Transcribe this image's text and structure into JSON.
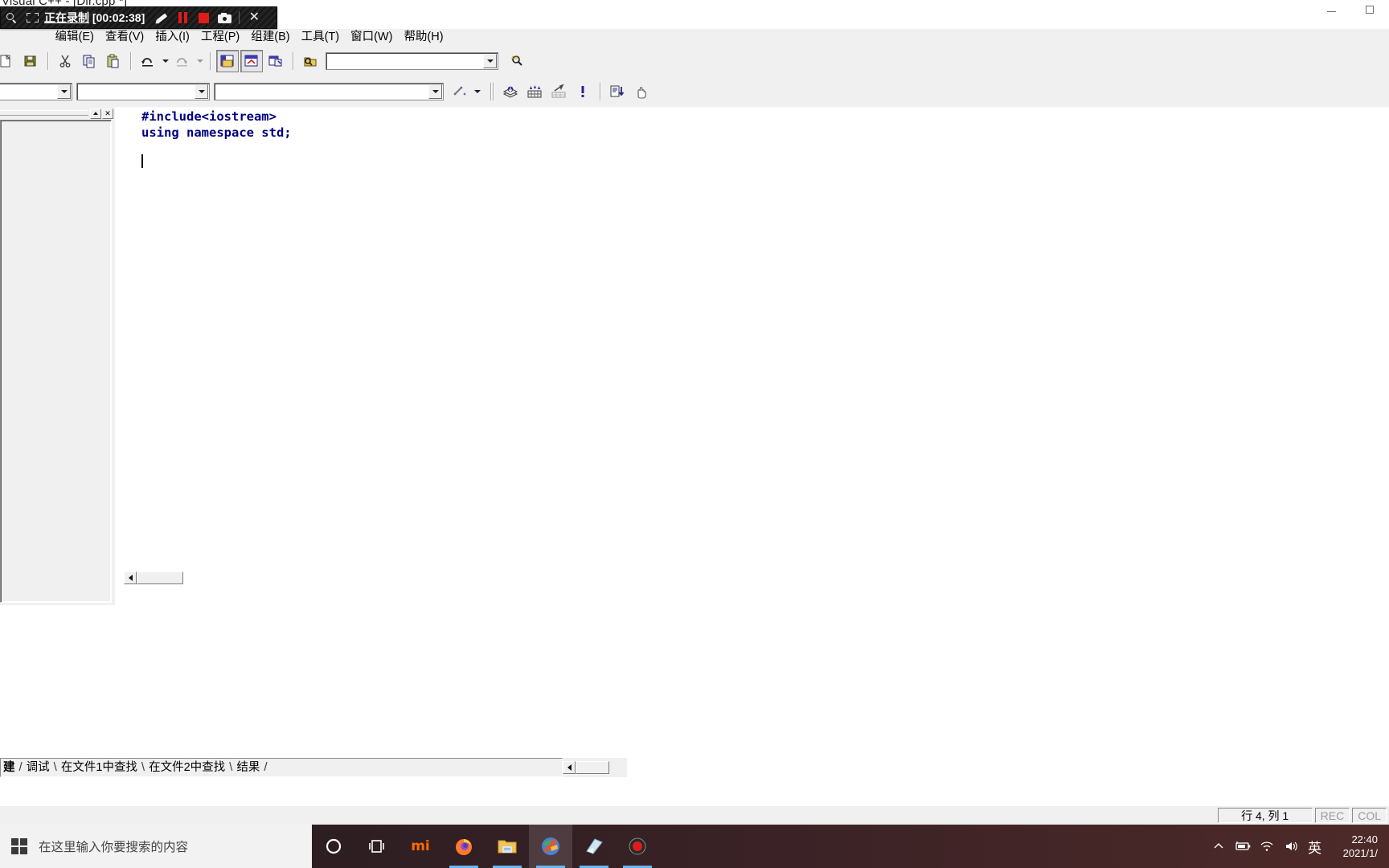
{
  "window": {
    "title": "Visual C++ - [Dir.cpp *]",
    "controls": {
      "minimize": "minimize-button",
      "maximize": "maximize-button"
    }
  },
  "recorder": {
    "status_cn": "正在录制",
    "timer": "[00:02:38]",
    "buttons": [
      {
        "name": "zoom-icon",
        "label": ""
      },
      {
        "name": "region-select-icon",
        "label": ""
      },
      {
        "name": "pencil-icon",
        "label": ""
      },
      {
        "name": "pause-icon",
        "label": ""
      },
      {
        "name": "stop-icon",
        "label": ""
      },
      {
        "name": "camera-icon",
        "label": ""
      },
      {
        "name": "close-icon",
        "label": "✕"
      }
    ]
  },
  "menu": {
    "items": [
      {
        "label": "编辑(E)",
        "key": "E"
      },
      {
        "label": "查看(V)",
        "key": "V"
      },
      {
        "label": "插入(I)",
        "key": "I"
      },
      {
        "label": "工程(P)",
        "key": "P"
      },
      {
        "label": "组建(B)",
        "key": "B"
      },
      {
        "label": "工具(T)",
        "key": "T"
      },
      {
        "label": "窗口(W)",
        "key": "W"
      },
      {
        "label": "帮助(H)",
        "key": "H"
      }
    ]
  },
  "toolbar_standard": {
    "find_combo": {
      "value": "",
      "placeholder": ""
    },
    "buttons": [
      "new-file-button",
      "save-button",
      "cut-button",
      "copy-button",
      "paste-button",
      "undo-button",
      "undo-dropdown",
      "redo-button",
      "redo-dropdown",
      "workspace-toggle-button",
      "output-toggle-button",
      "watch-toggle-button",
      "find-in-files-button",
      "find-combo",
      "find-next-button"
    ]
  },
  "toolbar_wizardbar": {
    "class_combo": {
      "value": ""
    },
    "filter_combo": {
      "value": ""
    },
    "member_combo": {
      "value": ""
    },
    "actions_label": "",
    "build_buttons": [
      "compile-button",
      "build-button",
      "rebuild-all-button",
      "stop-build-button",
      "execute-button",
      "pan-hand-button"
    ]
  },
  "workspace": {
    "caption_min": "▲",
    "caption_close": "✕"
  },
  "editor": {
    "lines": [
      "#include<iostream>",
      "using namespace std;",
      "",
      ""
    ],
    "code_color": "#000080",
    "caret_line": 4,
    "caret_col": 1
  },
  "output": {
    "tabs": [
      {
        "label": "建"
      },
      {
        "label": "调试"
      },
      {
        "label": "在文件1中查找"
      },
      {
        "label": "在文件2中查找"
      },
      {
        "label": "结果"
      }
    ]
  },
  "status": {
    "position": "行 4, 列 1",
    "rec": "REC",
    "col": "COL",
    "ovr": ""
  },
  "taskbar": {
    "search_placeholder": "在这里输入你要搜索的内容",
    "items": [
      {
        "name": "cortana-icon",
        "label": ""
      },
      {
        "name": "task-view-icon",
        "label": ""
      },
      {
        "name": "mi-browser-icon",
        "label": "mi"
      },
      {
        "name": "firefox-icon",
        "label": ""
      },
      {
        "name": "file-explorer-icon",
        "label": ""
      },
      {
        "name": "visual-cpp-icon",
        "label": ""
      },
      {
        "name": "notepad-icon",
        "label": ""
      },
      {
        "name": "screen-recorder-icon",
        "label": ""
      }
    ],
    "tray": {
      "ime": "英",
      "time": "22:40",
      "date": "2021/1/",
      "icons": [
        "chevron-up-icon",
        "battery-charging-icon",
        "wifi-icon",
        "volume-icon"
      ]
    }
  }
}
